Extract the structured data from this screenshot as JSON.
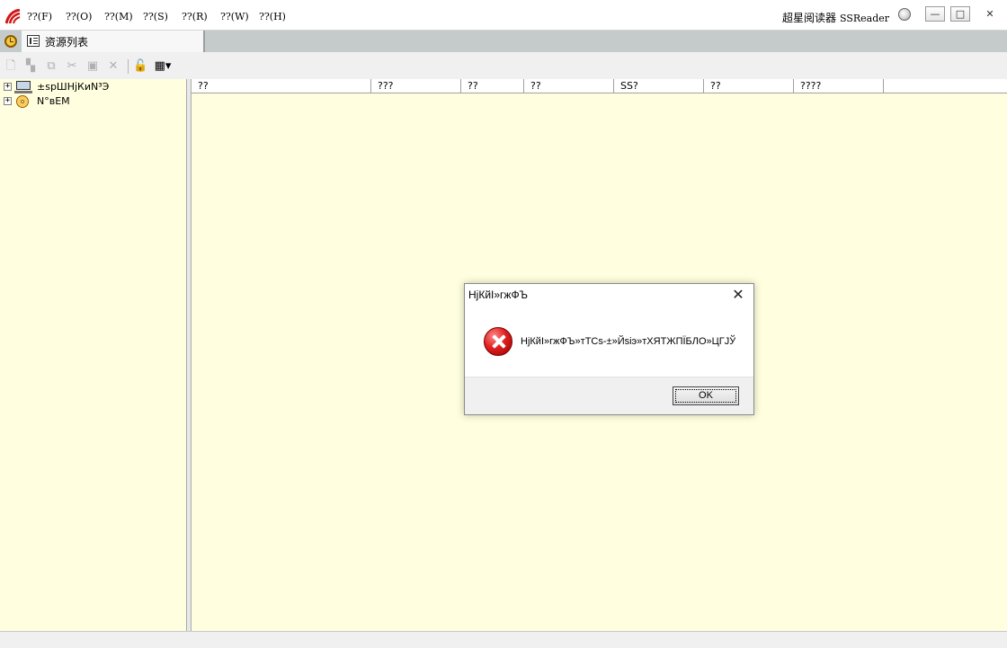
{
  "menubar": {
    "items": [
      "??(F)",
      "??(O)",
      "??(M)",
      "??(S)",
      "??(R)",
      "??(W)",
      "??(H)"
    ],
    "brand_cn": "超星阅读器",
    "brand_en": "SSReader",
    "minimize_glyph": "—",
    "restore_glyph": "□",
    "close_glyph": "✕"
  },
  "tabs": {
    "active_label": "资源列表"
  },
  "toolbar": {
    "icons": [
      "new-icon",
      "new-folder-icon",
      "copy-icon",
      "cut-icon",
      "paste-icon",
      "delete-icon",
      "lock-icon",
      "table-icon"
    ]
  },
  "tree": {
    "nodes": [
      {
        "label": "±spШНјКиN³Э",
        "icon": "computer-icon",
        "expander": "+"
      },
      {
        "label": "N°вЕМ",
        "icon": "cd-icon",
        "expander": "+"
      }
    ]
  },
  "list": {
    "columns": [
      "??",
      "???",
      "??",
      "??",
      "SS?",
      "??",
      "????"
    ]
  },
  "dialog": {
    "title": "НјКйІ»гжФЪ",
    "message": "НјКйІ»гжФЪ»тТСs-±»Йѕіэ»тХЯТЖПЇБЛО»ЦГЈЎ",
    "ok_label": "OK",
    "close_glyph": "✕",
    "accent_color": "#e02020"
  }
}
